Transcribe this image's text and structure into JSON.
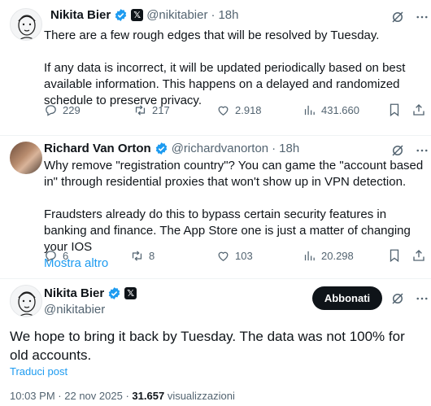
{
  "tweets": [
    {
      "name": "Nikita Bier",
      "handle": "@nikitabier",
      "sep": "·",
      "time": "18h",
      "paragraphs": [
        "There are a few rough edges that will be resolved by  Tuesday.",
        "If any data is incorrect, it will be updated periodically based on best available information. This happens on a delayed and randomized schedule to preserve privacy."
      ],
      "stats": {
        "replies": "229",
        "reposts": "217",
        "likes": "2.918",
        "views": "431.660"
      }
    },
    {
      "name": "Richard Van Orton",
      "handle": "@richardvanorton",
      "sep": "·",
      "time": "18h",
      "paragraphs": [
        "Why remove \"registration country\"? You can game the \"account based in\" through residential proxies that won't show up in VPN detection.",
        "Fraudsters already do this to bypass certain security features in banking and finance. The App Store one is just a matter of changing your IOS"
      ],
      "show_more": "Mostra altro",
      "stats": {
        "replies": "6",
        "reposts": "8",
        "likes": "103",
        "views": "20.298"
      }
    }
  ],
  "main": {
    "name": "Nikita Bier",
    "handle": "@nikitabier",
    "subscribe_label": "Abbonati",
    "text": "We hope to bring it back by Tuesday. The data was not 100% for old accounts.",
    "translate": "Traduci post",
    "time": "10:03 PM",
    "sep": "·",
    "date": "22 nov 2025",
    "views_count": "31.657",
    "views_label": "visualizzazioni"
  },
  "colors": {
    "accent": "#1d9bf0",
    "text": "#0f1419",
    "muted": "#536471"
  },
  "icons": [
    "verified-badge-icon",
    "x-affiliate-icon",
    "grok-icon",
    "more-icon",
    "reply-icon",
    "repost-icon",
    "like-icon",
    "views-icon",
    "bookmark-icon",
    "share-icon"
  ]
}
